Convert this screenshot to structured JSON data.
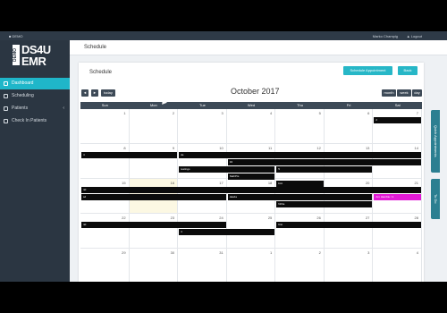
{
  "topbar": {
    "home": "■ DEMO",
    "user": "Marko Champig",
    "logout": "▲ Logout"
  },
  "logo": {
    "demo": "DEMO",
    "line1": "DS4U",
    "line2": "EMR"
  },
  "sidebar": {
    "items": [
      {
        "label": "Dashboard",
        "active": true
      },
      {
        "label": "Scheduling",
        "active": false
      },
      {
        "label": "Patients",
        "active": false,
        "caret": "‹"
      },
      {
        "label": "Check In Patients",
        "active": false
      }
    ]
  },
  "breadcrumb": "Schedule",
  "card": {
    "title": "Schedule",
    "schedule_appt_label": "Schedule Appointment",
    "back_label": "Back"
  },
  "calendar": {
    "prev_label": "◄",
    "next_label": "►",
    "today_label": "today",
    "month_title": "October 2017",
    "views": [
      "month",
      "week",
      "day"
    ],
    "weekdays": [
      "Sun",
      "Mon",
      "Tue",
      "Wed",
      "Thu",
      "Fri",
      "Sat"
    ],
    "weeks": [
      [
        "1",
        "2",
        "3",
        "4",
        "5",
        "6",
        "7"
      ],
      [
        "8",
        "9",
        "10",
        "11",
        "12",
        "13",
        "14"
      ],
      [
        "15",
        "16",
        "17",
        "18",
        "19",
        "20",
        "21"
      ],
      [
        "22",
        "23",
        "24",
        "25",
        "26",
        "27",
        "28"
      ],
      [
        "29",
        "30",
        "31",
        "1",
        "2",
        "3",
        "4"
      ]
    ],
    "events": [
      {
        "week": 0,
        "start": 6,
        "span": 1,
        "row": 0,
        "label": "2",
        "color": "black"
      },
      {
        "week": 1,
        "start": 0,
        "span": 2,
        "row": 0,
        "label": "4",
        "color": "black"
      },
      {
        "week": 1,
        "start": 2,
        "span": 5,
        "row": 0,
        "label": "de",
        "color": "black"
      },
      {
        "week": 1,
        "start": 3,
        "span": 4,
        "row": 1,
        "label": "34",
        "color": "black"
      },
      {
        "week": 1,
        "start": 2,
        "span": 2,
        "row": 2,
        "label": "testings",
        "color": "black"
      },
      {
        "week": 1,
        "start": 4,
        "span": 2,
        "row": 2,
        "label": "5",
        "color": "black"
      },
      {
        "week": 1,
        "start": 3,
        "span": 1,
        "row": 3,
        "label": "NathPts",
        "color": "black"
      },
      {
        "week": 1,
        "start": 4,
        "span": 1,
        "row": 4,
        "label": "kmt",
        "color": "black"
      },
      {
        "week": 2,
        "start": 0,
        "span": 7,
        "row": 0,
        "label": "4d",
        "color": "black"
      },
      {
        "week": 2,
        "start": 0,
        "span": 3,
        "row": 1,
        "label": "sd",
        "color": "black"
      },
      {
        "week": 2,
        "start": 3,
        "span": 3,
        "row": 1,
        "label": "dasda",
        "color": "black"
      },
      {
        "week": 2,
        "start": 6,
        "span": 1,
        "row": 1,
        "label": "Am Hamble / 1",
        "color": "pink"
      },
      {
        "week": 2,
        "start": 4,
        "span": 2,
        "row": 2,
        "label": "Nitha",
        "color": "black"
      },
      {
        "week": 3,
        "start": 0,
        "span": 3,
        "row": 0,
        "label": "4d",
        "color": "black"
      },
      {
        "week": 3,
        "start": 4,
        "span": 3,
        "row": 0,
        "label": "first",
        "color": "black"
      },
      {
        "week": 3,
        "start": 2,
        "span": 2,
        "row": 1,
        "label": "4",
        "color": "black"
      }
    ]
  },
  "side_tabs": [
    "Quick Appointments",
    "To Do"
  ],
  "colors": {
    "accent": "#27b7c7",
    "sidebar": "#2b3642",
    "header": "#3d4a57",
    "event": "#0b0b0b",
    "highlight": "#e21bd6"
  }
}
